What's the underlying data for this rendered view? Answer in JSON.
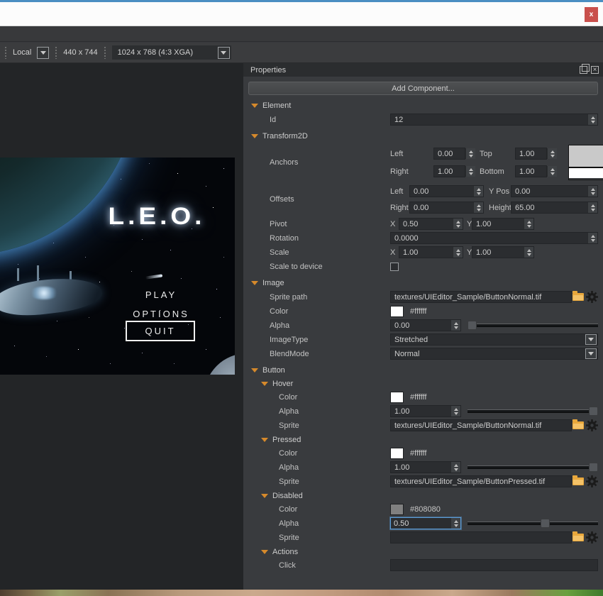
{
  "window": {
    "close": "x"
  },
  "toolbar": {
    "local": "Local",
    "size": "440 x 744",
    "resolution": "1024 x 768 (4:3 XGA)"
  },
  "preview": {
    "logo": "L.E.O.",
    "play": "PLAY",
    "options": "OPTIONS",
    "quit": "QUIT"
  },
  "panel": {
    "title": "Properties",
    "add_component": "Add Component...",
    "element": {
      "title": "Element",
      "id_label": "Id",
      "id": "12"
    },
    "transform": {
      "title": "Transform2D",
      "anchors_label": "Anchors",
      "anchors": {
        "left_label": "Left",
        "left": "0.00",
        "top_label": "Top",
        "top": "1.00",
        "right_label": "Right",
        "right": "1.00",
        "bottom_label": "Bottom",
        "bottom": "1.00"
      },
      "offsets_label": "Offsets",
      "offsets": {
        "left_label": "Left",
        "left": "0.00",
        "ypos_label": "Y Pos",
        "ypos": "0.00",
        "right_label": "Right",
        "right": "0.00",
        "height_label": "Height",
        "height": "65.00"
      },
      "pivot_label": "Pivot",
      "pivot": {
        "x_label": "X",
        "x": "0.50",
        "y_label": "Y",
        "y": "1.00"
      },
      "rotation_label": "Rotation",
      "rotation": "0.0000",
      "scale_label": "Scale",
      "scale": {
        "x_label": "X",
        "x": "1.00",
        "y_label": "Y",
        "y": "1.00"
      },
      "scale_to_device_label": "Scale to device"
    },
    "image": {
      "title": "Image",
      "sprite_path_label": "Sprite path",
      "sprite_path": "textures/UIEditor_Sample/ButtonNormal.tif",
      "color_label": "Color",
      "color": "#ffffff",
      "alpha_label": "Alpha",
      "alpha": "0.00",
      "imagetype_label": "ImageType",
      "imagetype": "Stretched",
      "blendmode_label": "BlendMode",
      "blendmode": "Normal"
    },
    "button": {
      "title": "Button",
      "hover": {
        "title": "Hover",
        "color_label": "Color",
        "color": "#ffffff",
        "alpha_label": "Alpha",
        "alpha": "1.00",
        "sprite_label": "Sprite",
        "sprite": "textures/UIEditor_Sample/ButtonNormal.tif"
      },
      "pressed": {
        "title": "Pressed",
        "color_label": "Color",
        "color": "#ffffff",
        "alpha_label": "Alpha",
        "alpha": "1.00",
        "sprite_label": "Sprite",
        "sprite": "textures/UIEditor_Sample/ButtonPressed.tif"
      },
      "disabled": {
        "title": "Disabled",
        "color_label": "Color",
        "color": "#808080",
        "alpha_label": "Alpha",
        "alpha": "0.50",
        "sprite_label": "Sprite",
        "sprite": ""
      },
      "actions": {
        "title": "Actions",
        "click_label": "Click"
      }
    }
  }
}
